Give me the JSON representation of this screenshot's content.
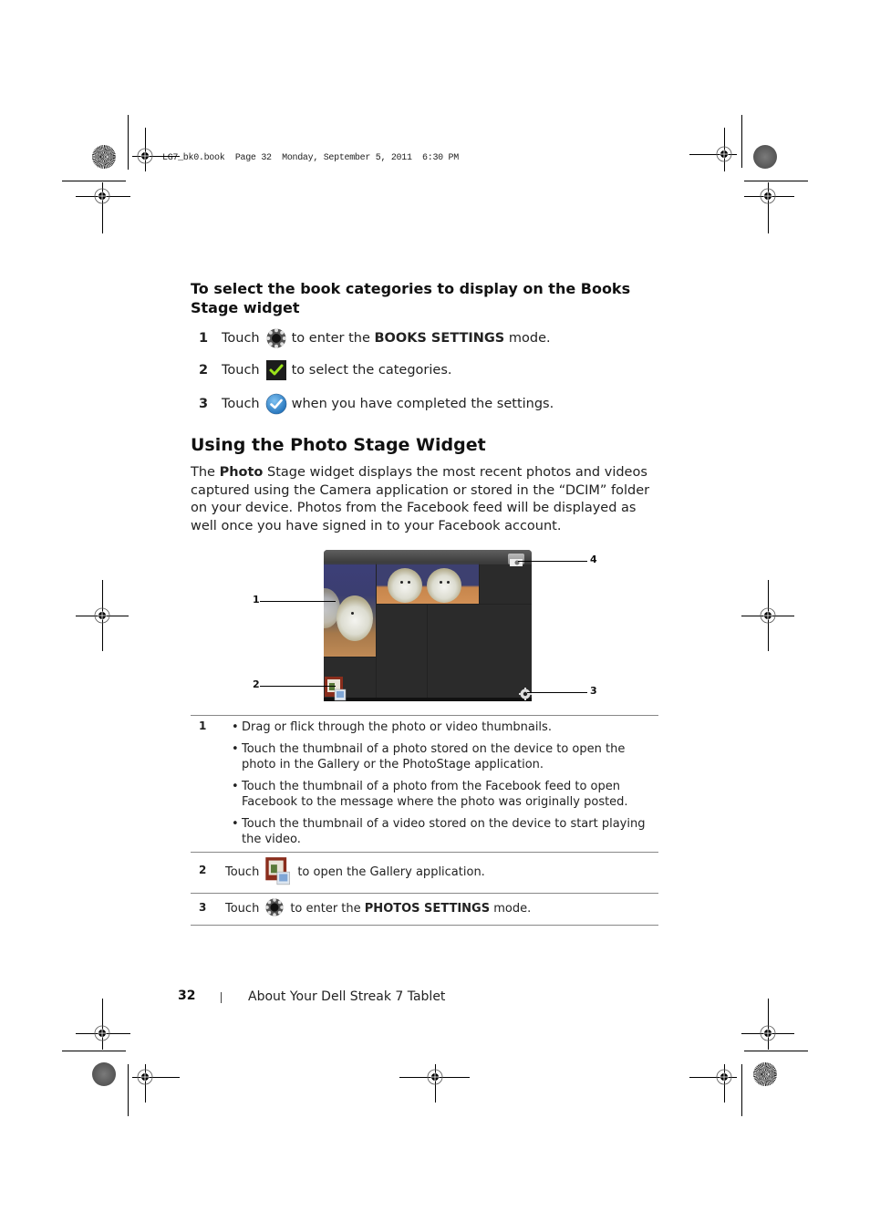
{
  "print_slug": "LG7_bk0.book  Page 32  Monday, September 5, 2011  6:30 PM",
  "procedure": {
    "heading": "To select the book categories to display on the Books Stage widget",
    "steps": [
      {
        "num": "1",
        "verb": "Touch",
        "icon": "gear-settings-icon",
        "text_before": "to enter the",
        "bold": "BOOKS SETTINGS",
        "text_after": "mode."
      },
      {
        "num": "2",
        "verb": "Touch",
        "icon": "checkmark-box-icon",
        "text_before": "to select the categories.",
        "bold": "",
        "text_after": ""
      },
      {
        "num": "3",
        "verb": "Touch",
        "icon": "blue-check-circle-icon",
        "text_before": "when you have completed the settings.",
        "bold": "",
        "text_after": ""
      }
    ]
  },
  "section": {
    "title": "Using the Photo Stage Widget",
    "intro_pre": "The",
    "intro_bold": "Photo",
    "intro_post": "Stage widget displays the most recent photos and videos captured using the Camera application or stored in the “DCIM” folder on your device. Photos from the Facebook feed will be displayed as well once you have signed in to your Facebook account."
  },
  "figure": {
    "callouts": [
      "1",
      "2",
      "3",
      "4"
    ]
  },
  "table": {
    "rows": [
      {
        "num": "1",
        "bullets": [
          "Drag or flick through the photo or video thumbnails.",
          "Touch the thumbnail of a photo stored on the device to open the photo in the Gallery or the PhotoStage application.",
          "Touch the thumbnail of a photo from the Facebook feed to open Facebook to the message where the photo was originally posted.",
          "Touch the thumbnail of a video stored on the device to start playing the video."
        ]
      },
      {
        "num": "2",
        "verb": "Touch",
        "icon": "gallery-icon",
        "text": "to open the Gallery application.",
        "bold": "",
        "after": ""
      },
      {
        "num": "3",
        "verb": "Touch",
        "icon": "gear-settings-icon",
        "text": "to enter the",
        "bold": "PHOTOS SETTINGS",
        "after": "mode."
      }
    ]
  },
  "footer": {
    "page_number": "32",
    "title": "About Your Dell Streak 7 Tablet"
  }
}
